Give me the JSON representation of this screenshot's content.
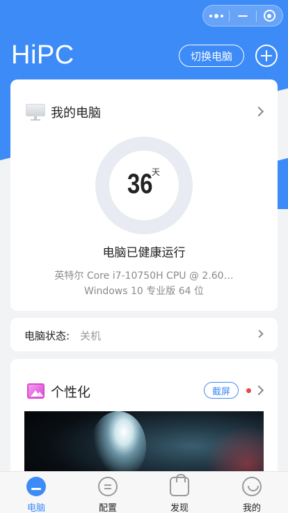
{
  "app": {
    "title": "HiPC",
    "switch_label": "切换电脑"
  },
  "pc_card": {
    "title": "我的电脑",
    "uptime_days": "36",
    "uptime_unit": "天",
    "health_text": "电脑已健康运行",
    "cpu": "英特尔 Core i7-10750H CPU @ 2.60…",
    "os": "Windows 10 专业版 64 位"
  },
  "status": {
    "label": "电脑状态:",
    "value": "关机"
  },
  "personalize": {
    "title": "个性化",
    "screenshot_label": "截屏"
  },
  "tabs": [
    {
      "label": "电脑",
      "icon": "computer-icon",
      "active": true
    },
    {
      "label": "配置",
      "icon": "config-icon",
      "active": false
    },
    {
      "label": "发现",
      "icon": "bag-icon",
      "active": false
    },
    {
      "label": "我的",
      "icon": "smile-icon",
      "active": false
    }
  ],
  "colors": {
    "accent": "#3d8bf7",
    "background": "#f2f3f5",
    "dot": "#e5484d"
  }
}
